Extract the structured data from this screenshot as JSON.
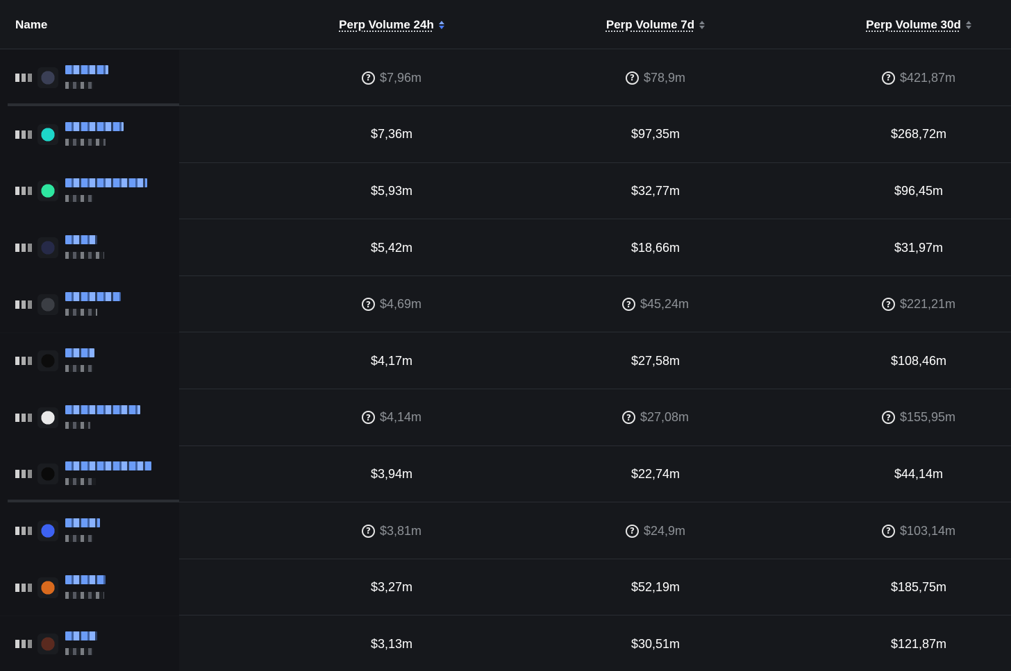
{
  "header": {
    "name": "Name",
    "col_24h": "Perp Volume 24h",
    "col_7d": "Perp Volume 7d",
    "col_30d": "Perp Volume 30d"
  },
  "colors": {
    "background": "#16181c",
    "sticky_column": "#131418",
    "accent_blue": "#4a7cff",
    "muted_text": "#8e9297"
  },
  "rows": [
    {
      "vol_24h": "$7,96m",
      "vol_7d": "$78,9m",
      "vol_30d": "$421,87m",
      "unverified": true,
      "avatar": "#3a3f55"
    },
    {
      "vol_24h": "$7,36m",
      "vol_7d": "$97,35m",
      "vol_30d": "$268,72m",
      "unverified": false,
      "avatar": "#1dd6c9"
    },
    {
      "vol_24h": "$5,93m",
      "vol_7d": "$32,77m",
      "vol_30d": "$96,45m",
      "unverified": false,
      "avatar": "#2ee6a0"
    },
    {
      "vol_24h": "$5,42m",
      "vol_7d": "$18,66m",
      "vol_30d": "$31,97m",
      "unverified": false,
      "avatar": "#262a48"
    },
    {
      "vol_24h": "$4,69m",
      "vol_7d": "$45,24m",
      "vol_30d": "$221,21m",
      "unverified": true,
      "avatar": "#3b3e44"
    },
    {
      "vol_24h": "$4,17m",
      "vol_7d": "$27,58m",
      "vol_30d": "$108,46m",
      "unverified": false,
      "avatar": "#0c0c0c"
    },
    {
      "vol_24h": "$4,14m",
      "vol_7d": "$27,08m",
      "vol_30d": "$155,95m",
      "unverified": true,
      "avatar": "#e9e9e9"
    },
    {
      "vol_24h": "$3,94m",
      "vol_7d": "$22,74m",
      "vol_30d": "$44,14m",
      "unverified": false,
      "avatar": "#0a0a0a"
    },
    {
      "vol_24h": "$3,81m",
      "vol_7d": "$24,9m",
      "vol_30d": "$103,14m",
      "unverified": true,
      "avatar": "#3d62f2"
    },
    {
      "vol_24h": "$3,27m",
      "vol_7d": "$52,19m",
      "vol_30d": "$185,75m",
      "unverified": false,
      "avatar": "#d96a1e"
    },
    {
      "vol_24h": "$3,13m",
      "vol_7d": "$30,51m",
      "vol_30d": "$121,87m",
      "unverified": false,
      "avatar": "#5a2a1f"
    }
  ]
}
